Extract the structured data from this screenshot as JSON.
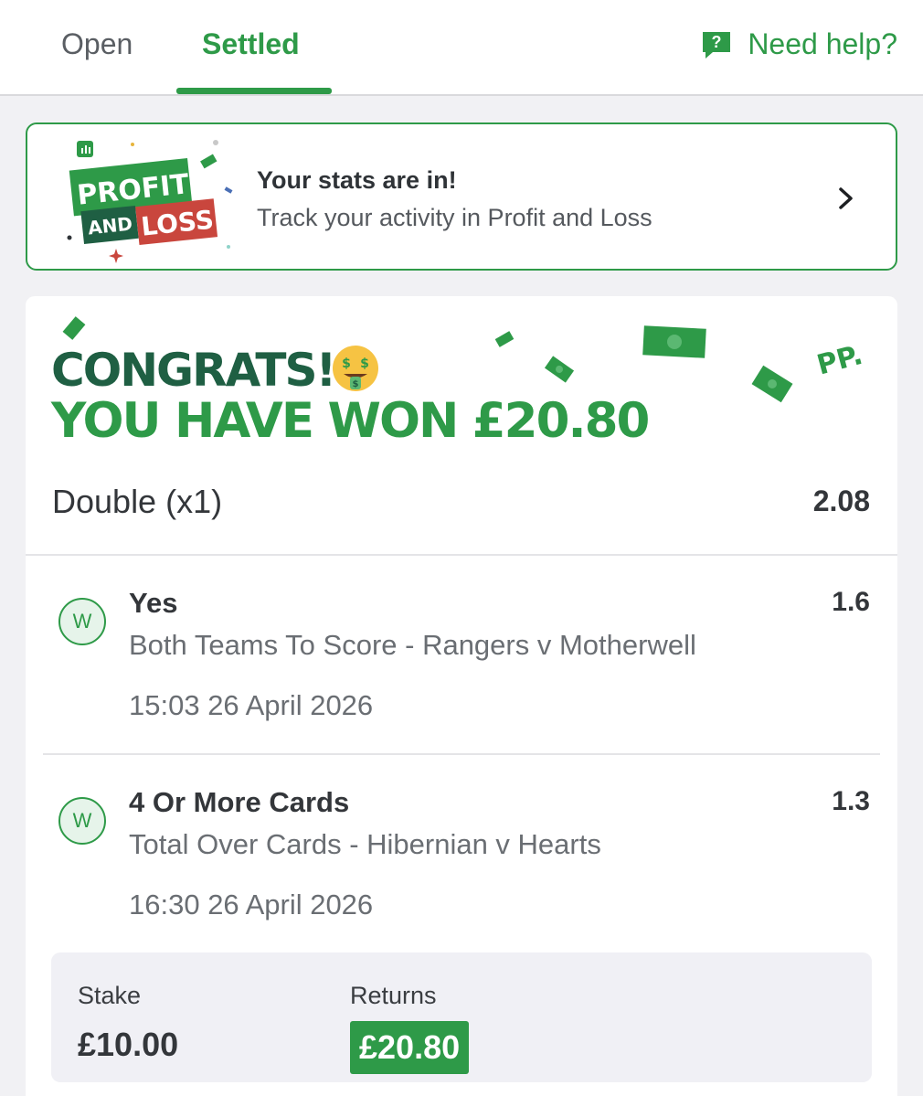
{
  "tabs": {
    "open_label": "Open",
    "settled_label": "Settled",
    "help_label": "Need help?"
  },
  "banner": {
    "art_text_1": "PROFIT",
    "art_text_2": "AND",
    "art_text_3": "LOSS",
    "title": "Your stats are in!",
    "subtitle": "Track your activity in Profit and Loss"
  },
  "bet": {
    "congrats": "CONGRATS!",
    "won_text": "YOU HAVE WON £20.80",
    "pp_mark": "PP.",
    "type_label": "Double (x1)",
    "total_odds": "2.08",
    "selections": [
      {
        "status": "W",
        "name": "Yes",
        "market": "Both Teams To Score - Rangers v Motherwell",
        "time": "15:03 26 April 2026",
        "odds": "1.6"
      },
      {
        "status": "W",
        "name": "4 Or More Cards",
        "market": "Total Over Cards - Hibernian v Hearts",
        "time": "16:30 26 April 2026",
        "odds": "1.3"
      }
    ],
    "stake_label": "Stake",
    "stake_value": "£10.00",
    "returns_label": "Returns",
    "returns_value": "£20.80"
  },
  "colors": {
    "brand_green": "#2e9a48",
    "dark_green": "#1f5f43",
    "loss_red": "#c9463d"
  }
}
